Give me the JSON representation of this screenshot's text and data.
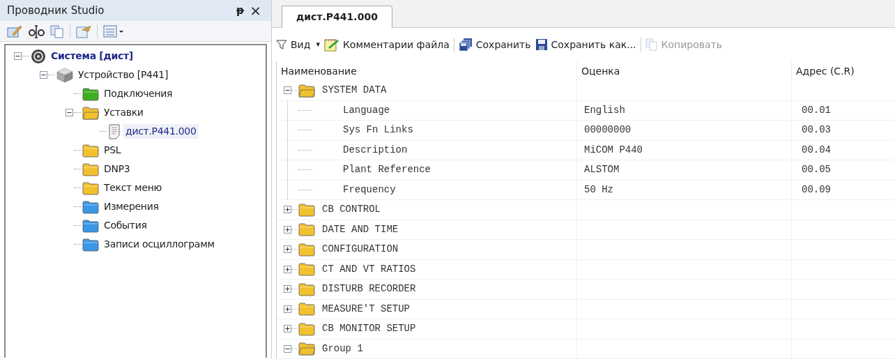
{
  "explorer": {
    "title": "Проводник Studio",
    "pin": "ᵽ",
    "close": "×",
    "toolbar": [
      {
        "kind": "edit"
      },
      {
        "kind": "rename"
      },
      {
        "kind": "copy"
      },
      {
        "kind": "separator"
      },
      {
        "kind": "properties"
      },
      {
        "kind": "separator"
      },
      {
        "kind": "view"
      }
    ],
    "tree": [
      {
        "label": "Система [дист]",
        "kind": "system",
        "expanded": true,
        "selected": false,
        "children": [
          {
            "label": "Устройство [P441]",
            "kind": "device",
            "expanded": true,
            "selected": false,
            "children": [
              {
                "label": "Подключения",
                "kind": "folder",
                "color": "#3fae1e",
                "selected": false
              },
              {
                "label": "Уставки",
                "kind": "folder-open",
                "color": "#f2c12e",
                "expanded": true,
                "selected": false,
                "children": [
                  {
                    "label": "дист.P441.000",
                    "kind": "file",
                    "selected": true
                  }
                ]
              },
              {
                "label": "PSL",
                "kind": "folder",
                "color": "#f2c12e",
                "selected": false
              },
              {
                "label": "DNP3",
                "kind": "folder",
                "color": "#f2c12e",
                "selected": false
              },
              {
                "label": "Текст меню",
                "kind": "folder",
                "color": "#f2c12e",
                "selected": false
              },
              {
                "label": "Измерения",
                "kind": "folder",
                "color": "#3a97e8",
                "selected": false
              },
              {
                "label": "События",
                "kind": "folder",
                "color": "#3a97e8",
                "selected": false
              },
              {
                "label": "Записи осциллограмм",
                "kind": "folder",
                "color": "#3a97e8",
                "selected": false
              }
            ]
          }
        ]
      }
    ]
  },
  "document": {
    "tabs": [
      {
        "label": "дист.P441.000",
        "selected": true
      }
    ],
    "toolbar": [
      {
        "label": "Вид",
        "kind": "filter",
        "dropdown": "▾",
        "disabled": false
      },
      {
        "label": "Комментарии файла",
        "kind": "comment",
        "disabled": false
      },
      {
        "kind": "separator"
      },
      {
        "label": "Сохранить",
        "kind": "save-all",
        "disabled": false
      },
      {
        "label": "Сохранить как...",
        "kind": "save",
        "disabled": false
      },
      {
        "kind": "separator"
      },
      {
        "label": "Копировать",
        "kind": "copy",
        "disabled": true
      }
    ],
    "columns": [
      "Наименование",
      "Оценка",
      "Адрес (C.R)"
    ],
    "rows": [
      {
        "name": "SYSTEM DATA",
        "expanded": true,
        "children": [
          {
            "name": "Language",
            "value": "English",
            "address": "00.01"
          },
          {
            "name": "Sys Fn Links",
            "value": "00000000",
            "address": "00.03"
          },
          {
            "name": "Description",
            "value": "MiCOM P440",
            "address": "00.04"
          },
          {
            "name": "Plant Reference",
            "value": "ALSTOM",
            "address": "00.05"
          },
          {
            "name": "Frequency",
            "value": "50 Hz",
            "address": "00.09"
          }
        ]
      },
      {
        "name": "CB CONTROL",
        "expanded": false
      },
      {
        "name": "DATE AND TIME",
        "expanded": false
      },
      {
        "name": "CONFIGURATION",
        "expanded": false
      },
      {
        "name": "CT AND VT RATIOS",
        "expanded": false
      },
      {
        "name": "DISTURB RECORDER",
        "expanded": false
      },
      {
        "name": "MEASURE'T SETUP",
        "expanded": false
      },
      {
        "name": "CB MONITOR SETUP",
        "expanded": false
      },
      {
        "name": "Group 1",
        "expanded": true
      }
    ]
  }
}
